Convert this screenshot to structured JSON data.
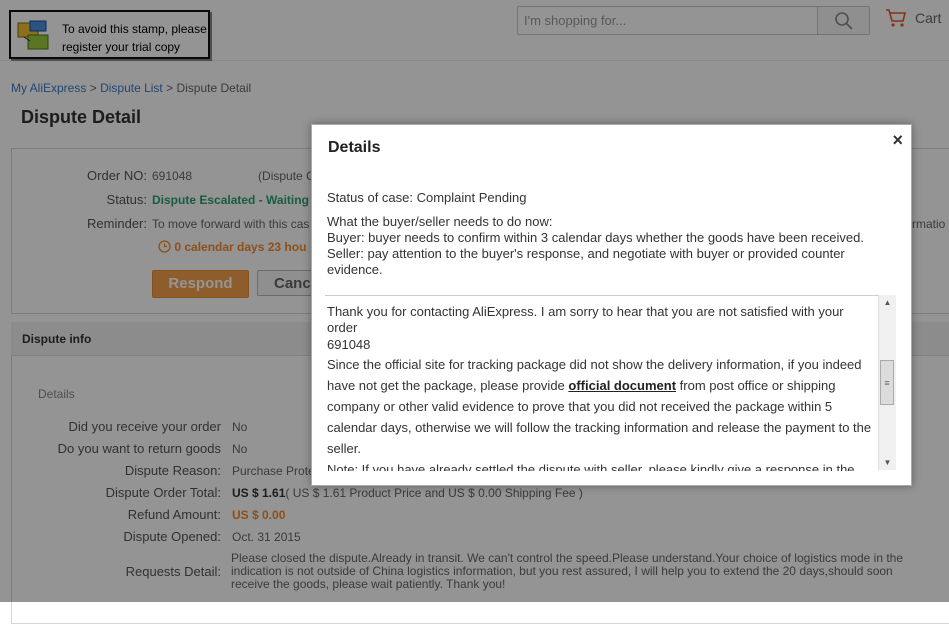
{
  "header": {
    "search_placeholder": "I'm shopping for...",
    "cart_label": "Cart",
    "stamp_text_line1": "To avoid this stamp, please",
    "stamp_text_line2": "register your trial copy"
  },
  "breadcrumb": {
    "items": [
      "My AliExpress",
      "Dispute List",
      "Dispute Detail"
    ],
    "separator": ">"
  },
  "page_title": "Dispute Detail",
  "order": {
    "order_no_label": "Order NO:",
    "order_no_value": "691048",
    "order_no_suffix": "(Dispute O",
    "status_label": "Status:",
    "status_value": "Dispute Escalated - Waiting f",
    "reminder_label": "Reminder:",
    "reminder_value": "To move forward with this cas",
    "reminder_right": "rmatio",
    "countdown": "0 calendar days 23 hou",
    "respond_label": "Respond",
    "cancel_label": "Cance"
  },
  "dispute_info": {
    "header": "Dispute info",
    "subheader": "Details",
    "rows": [
      {
        "label": "Did you receive your order",
        "value": "No"
      },
      {
        "label": "Do you want to return goods",
        "value": "No"
      },
      {
        "label": "Dispute Reason:",
        "value": "Purchase Prote"
      },
      {
        "label": "Dispute Order Total:",
        "value": "US $ 1.61",
        "extra": "( US $ 1.61 Product Price and US $ 0.00 Shipping Fee )"
      },
      {
        "label": "Refund Amount:",
        "value": "US $ 0.00"
      },
      {
        "label": "Dispute Opened:",
        "value": "Oct. 31 2015"
      },
      {
        "label": "Requests Detail:",
        "value": "Please closed the dispute.Already in transit. We can't control the speed.Please understand.Your choice of logistics mode in the indication is not outside of China logistics information, but you rest assured, I will help you to extend the 20 days,should soon receive the goods, please wait patiently. Thank you!"
      }
    ]
  },
  "modal": {
    "title": "Details",
    "close": "×",
    "status_line": "Status of case: Complaint Pending",
    "todo_line": "What the buyer/seller needs to do now:",
    "buyer_line": "Buyer: buyer needs to confirm within 3 calendar days whether the goods have been received.",
    "seller_line": "Seller: pay attention to the buyer's response, and negotiate with buyer or provided counter evidence.",
    "msg_intro": "Thank you for contacting AliExpress. I am sorry to hear that you are not satisfied with your order",
    "msg_order": "691048",
    "msg_part1": "Since the official site for tracking package did not show the delivery information, if you indeed have not get the package, please provide ",
    "msg_emph": "official document",
    "msg_part2": " from post office or shipping company or other valid evidence to prove that you did not received the package within 5 calendar days, otherwise we will follow the tracking information and release the payment to the seller.",
    "msg_note": "Note: If you have already settled the dispute with seller, please kindly give a response in the complaint center so that we can be informed and follow this dispute based on the settlement."
  },
  "colors": {
    "link": "#3d78c7",
    "status_green": "#2aa06f",
    "accent_orange": "#f48a2a",
    "respond_bg": "#f7a04b"
  }
}
